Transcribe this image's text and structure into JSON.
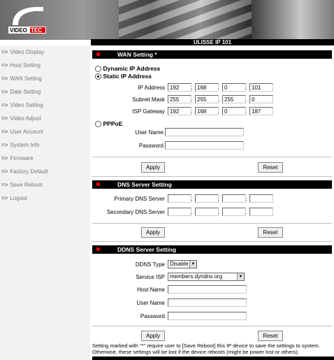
{
  "header": {
    "title": "ULISSE IP 101",
    "logo_text": "VIDEOTEC"
  },
  "sidebar": {
    "items": [
      {
        "arrow": "=>",
        "label": "Video Display"
      },
      {
        "arrow": "=>",
        "label": "Host Setting"
      },
      {
        "arrow": "=>",
        "label": "WAN Setting"
      },
      {
        "arrow": "=>",
        "label": "Date Setting"
      },
      {
        "arrow": "=>",
        "label": "Video Setting"
      },
      {
        "arrow": "=>",
        "label": "Video Adjust"
      },
      {
        "arrow": "=>",
        "label": "User Account"
      },
      {
        "arrow": "=>",
        "label": "System Info"
      },
      {
        "arrow": "=>",
        "label": "Firmware"
      },
      {
        "arrow": "=>",
        "label": "Factory Default"
      },
      {
        "arrow": "=>",
        "label": "Save Reboot"
      },
      {
        "arrow": "=>",
        "label": "Logout"
      }
    ]
  },
  "wan": {
    "title": "WAN Setting *",
    "dynamic_label": "Dynamic IP Address",
    "static_label": "Static IP Address",
    "pppoe_label": "PPPoE",
    "selected": "static",
    "ip_label": "IP Address",
    "ip": [
      "192",
      "168",
      "0",
      "101"
    ],
    "mask_label": "Subnet Mask",
    "mask": [
      "255",
      "255",
      "255",
      "0"
    ],
    "gateway_label": "ISP Gateway",
    "gateway": [
      "192",
      "168",
      "0",
      "187"
    ],
    "user_label": "User Name",
    "user_value": "",
    "password_label": "Password",
    "password_value": "",
    "apply": "Apply",
    "reset": "Reset"
  },
  "dns": {
    "title": "DNS Server Setting",
    "primary_label": "Primary DNS Server",
    "primary": [
      "",
      "",
      "",
      ""
    ],
    "secondary_label": "Secondary DNS Server",
    "secondary": [
      "",
      "",
      "",
      ""
    ],
    "apply": "Apply",
    "reset": "Reset"
  },
  "ddns": {
    "title": "DDNS Server Setting",
    "type_label": "DDNS Type",
    "type_value": "Disable",
    "isp_label": "Service ISP",
    "isp_value": "members.dyndns.org",
    "host_label": "Host Name",
    "host_value": "",
    "user_label": "User Name",
    "user_value": "",
    "password_label": "Password",
    "password_value": "",
    "apply": "Apply",
    "reset": "Reset"
  },
  "footer_note": "Setting marked with \"*\" require user to [Save Reboot] this IP device to save the settings to system. Otherwise, these settings will be lost if the device reboots (might be power lost or others).",
  "dot_char": ".",
  "dropdown_arrow": "▼"
}
